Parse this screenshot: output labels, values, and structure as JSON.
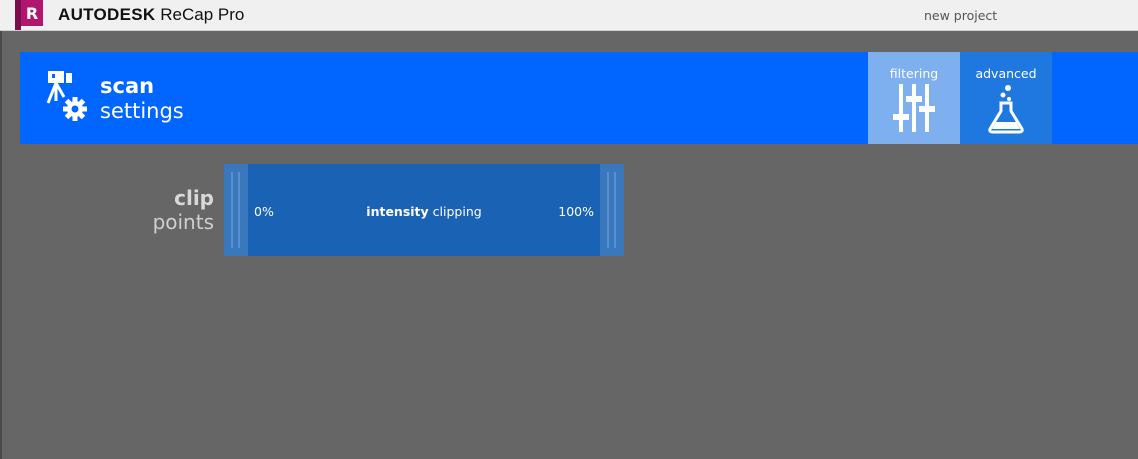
{
  "titlebar": {
    "logo_letter": "R",
    "brand_company": "AUTODESK",
    "brand_product": "ReCap Pro",
    "project_name": "new project"
  },
  "header": {
    "title_line1": "scan",
    "title_line2": "settings",
    "icon": "scan-settings-icon",
    "tabs": [
      {
        "label": "filtering",
        "icon": "sliders-icon",
        "active": true
      },
      {
        "label": "advanced",
        "icon": "flask-icon",
        "active": false
      }
    ]
  },
  "clip": {
    "label_line1": "clip",
    "label_line2": "points",
    "slider": {
      "title_bold": "intensity",
      "title_rest": "clipping",
      "min_label": "0%",
      "max_label": "100%",
      "min_value": 0,
      "max_value": 100
    }
  },
  "colors": {
    "header_blue": "#0066ff",
    "tab_active": "#7eafef",
    "tab_inactive": "#1f78e0",
    "slider_blue": "#1a62b3",
    "background": "#666666"
  }
}
